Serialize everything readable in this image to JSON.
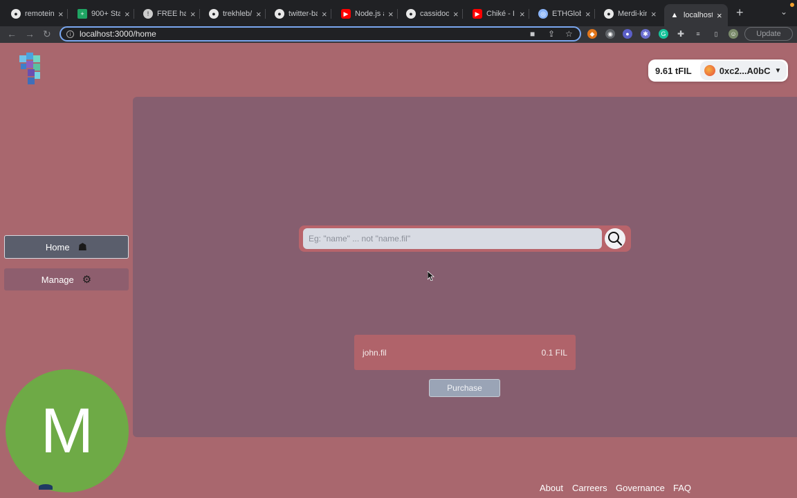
{
  "browser": {
    "tabs": [
      {
        "label": "remoteint",
        "icon": "github-icon",
        "color": "#e8e8e8"
      },
      {
        "label": "900+ Sta",
        "icon": "sheets-icon",
        "color": "#1fa463"
      },
      {
        "label": "FREE har",
        "icon": "info-icon",
        "color": "#cccccc"
      },
      {
        "label": "trekhleb/j",
        "icon": "github-icon",
        "color": "#e8e8e8"
      },
      {
        "label": "twitter-ba",
        "icon": "github-icon",
        "color": "#e8e8e8"
      },
      {
        "label": "Node.js a",
        "icon": "youtube-icon",
        "color": "#ff0000"
      },
      {
        "label": "cassidoo/",
        "icon": "github-icon",
        "color": "#e8e8e8"
      },
      {
        "label": "Chiké - I",
        "icon": "youtube-icon",
        "color": "#ff0000"
      },
      {
        "label": "ETHGloba",
        "icon": "globe-icon",
        "color": "#8ab4f8"
      },
      {
        "label": "Merdi-kin",
        "icon": "github-icon",
        "color": "#e8e8e8"
      },
      {
        "label": "localhost",
        "icon": "triangle-icon",
        "color": "#ffffff",
        "active": true
      }
    ],
    "url": "localhost:3000/home",
    "update_label": "Update"
  },
  "header": {
    "balance": "9.61 tFIL",
    "account": "0xc2...A0bC"
  },
  "sidebar": {
    "items": [
      {
        "label": "Home",
        "icon": "home-icon"
      },
      {
        "label": "Manage",
        "icon": "gear-icon"
      }
    ]
  },
  "search": {
    "placeholder": "Eg: \"name\" ... not \"name.fil\""
  },
  "result": {
    "name": "john.fil",
    "price": "0.1 FIL",
    "purchase_label": "Purchase"
  },
  "avatar": {
    "initial": "M"
  },
  "footer": {
    "links": [
      "About",
      "Carreers",
      "Governance",
      "FAQ"
    ]
  },
  "colors": {
    "background": "#a9676e",
    "panel": "#865e6f",
    "avatar": "#6eaa46"
  }
}
